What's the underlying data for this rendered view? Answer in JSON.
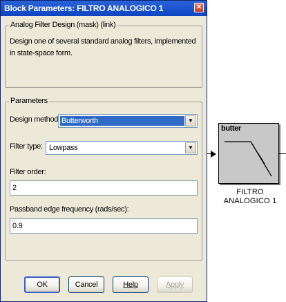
{
  "dialog": {
    "title": "Block Parameters: FILTRO ANALOGICO 1",
    "close_glyph": "✕",
    "mask_group": {
      "legend": "Analog Filter Design (mask) (link)",
      "description": "Design one of several standard analog filters, implemented in state-space form."
    },
    "parameters": {
      "legend": "Parameters",
      "design_method": {
        "label": "Design method:",
        "value": "Butterworth",
        "arrow": "▼"
      },
      "filter_type": {
        "label": "Filter type:",
        "value": "Lowpass",
        "arrow": "▼"
      },
      "filter_order": {
        "label": "Filter order:",
        "value": "2"
      },
      "passband_edge": {
        "label": "Passband edge frequency (rads/sec):",
        "value": "0.9"
      }
    },
    "buttons": {
      "ok": "OK",
      "cancel": "Cancel",
      "help": "Help",
      "apply": "Apply"
    }
  },
  "canvas": {
    "block": {
      "icon_text": "butter",
      "name_line1": "FILTRO",
      "name_line2": "ANALOGICO 1"
    }
  },
  "icons": {
    "close": "close-icon",
    "dropdown": "chevron-down-icon",
    "filter_response": "lowpass-response-icon"
  },
  "colors": {
    "titlebar": "#1f57d1",
    "dialog_bg": "#ece9d8",
    "selection": "#316ac5",
    "block_fill": "#c8c8c8"
  }
}
